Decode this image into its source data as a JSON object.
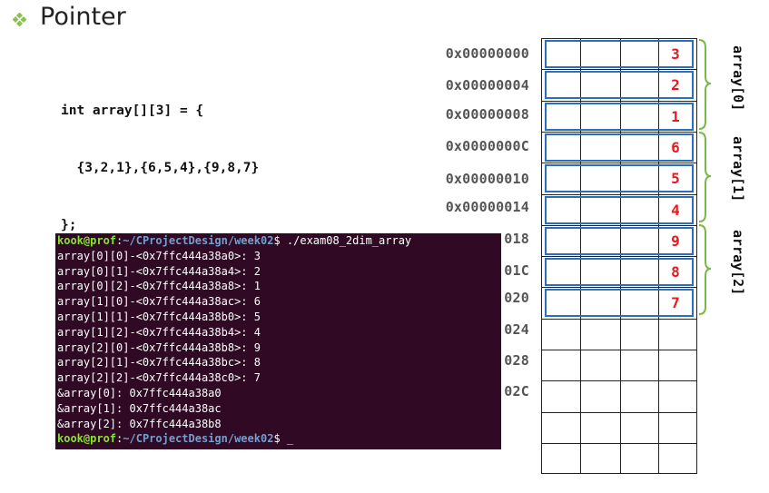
{
  "slide": {
    "title": "Pointer",
    "bullet_icon": "diamond-bullet-icon",
    "accent_color": "#7ab648"
  },
  "code": {
    "lines": [
      "int array[][3] = {",
      "  {3,2,1},{6,5,4},{9,8,7}",
      "};"
    ]
  },
  "memory": {
    "addresses": [
      "0x00000000",
      "0x00000004",
      "0x00000008",
      "0x0000000C",
      "0x00000010",
      "0x00000014",
      "018",
      "01C",
      "020",
      "024",
      "028",
      "02C"
    ],
    "values": [
      "3",
      "2",
      "1",
      "6",
      "5",
      "4",
      "9",
      "8",
      "7"
    ],
    "group_labels": [
      "array[0]",
      "array[1]",
      "array[2]"
    ],
    "value_color": "#e8191c",
    "highlight_color": "#2a6fbf"
  },
  "terminal": {
    "prompt_user": "kook@prof",
    "prompt_sep": ":",
    "prompt_path": "~/CProjectDesign/week02",
    "prompt_symbol": "$ ",
    "command": "./exam08_2dim_array",
    "output": [
      "array[0][0]-<0x7ffc444a38a0>: 3",
      "array[0][1]-<0x7ffc444a38a4>: 2",
      "array[0][2]-<0x7ffc444a38a8>: 1",
      "array[1][0]-<0x7ffc444a38ac>: 6",
      "array[1][1]-<0x7ffc444a38b0>: 5",
      "array[1][2]-<0x7ffc444a38b4>: 4",
      "array[2][0]-<0x7ffc444a38b8>: 9",
      "array[2][1]-<0x7ffc444a38bc>: 8",
      "array[2][2]-<0x7ffc444a38c0>: 7",
      "&array[0]: 0x7ffc444a38a0",
      "&array[1]: 0x7ffc444a38ac",
      "&array[2]: 0x7ffc444a38b8"
    ],
    "cursor": "_"
  }
}
